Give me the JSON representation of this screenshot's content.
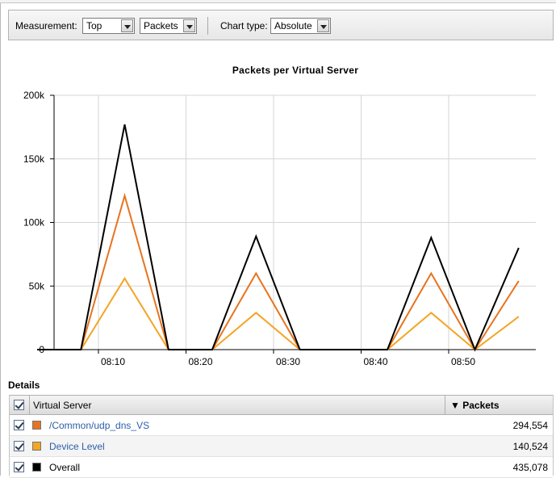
{
  "toolbar": {
    "measurement_label": "Measurement:",
    "measurement_value": "Top",
    "metric_value": "Packets",
    "chart_type_label": "Chart type:",
    "chart_type_value": "Absolute"
  },
  "chart_data": {
    "type": "line",
    "title": "Packets per Virtual Server",
    "xlabel": "",
    "ylabel": "",
    "x_ticks": [
      "08:10",
      "08:20",
      "08:30",
      "08:40",
      "08:50"
    ],
    "y_ticks": [
      "0",
      "50k",
      "100k",
      "150k",
      "200k"
    ],
    "ylim": [
      0,
      200000
    ],
    "x_minutes": [
      3,
      8,
      13,
      18,
      23,
      28,
      33,
      38,
      43,
      48,
      53,
      58,
      63
    ],
    "series": [
      {
        "name": "Overall",
        "color": "#000000",
        "values": [
          0,
          0,
          177000,
          0,
          0,
          89000,
          0,
          0,
          0,
          88000,
          0,
          80000,
          null
        ]
      },
      {
        "name": "/Common/udp_dns_VS",
        "color": "#e8731e",
        "values": [
          0,
          0,
          121000,
          0,
          0,
          60000,
          0,
          0,
          0,
          60000,
          0,
          54000,
          null
        ]
      },
      {
        "name": "Device Level",
        "color": "#f3a524",
        "values": [
          0,
          0,
          56000,
          0,
          0,
          29000,
          0,
          0,
          0,
          29000,
          0,
          26000,
          null
        ]
      }
    ]
  },
  "details": {
    "title": "Details",
    "header": {
      "col_server": "Virtual Server",
      "col_packets": "▼ Packets"
    },
    "rows": [
      {
        "name": "/Common/udp_dns_VS",
        "value": "294,554",
        "color": "#e8731e",
        "link": true
      },
      {
        "name": "Device Level",
        "value": "140,524",
        "color": "#f3a524",
        "link": true
      },
      {
        "name": "Overall",
        "value": "435,078",
        "color": "#000000",
        "link": false
      }
    ]
  }
}
